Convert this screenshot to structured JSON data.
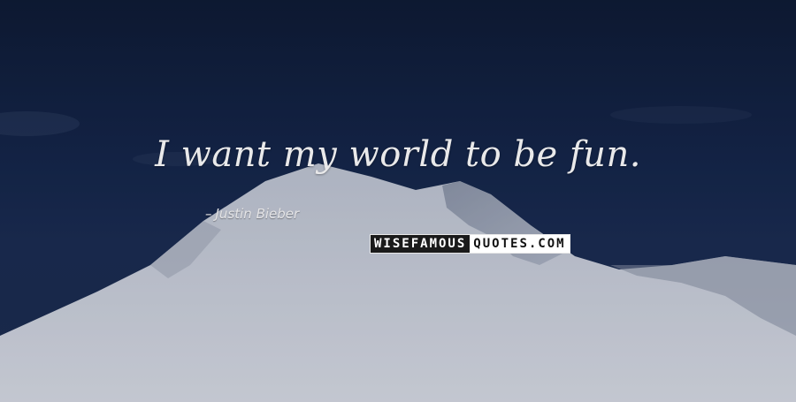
{
  "quote": {
    "text": "I want my world to be fun.",
    "author": "Justin Bieber",
    "author_marker": "–"
  },
  "watermark": {
    "part_a": "WISEFAMOUS",
    "part_b": "QUOTES.COM"
  },
  "colors": {
    "sky_top": "#0e1a33",
    "sky_bottom": "#1d2d50",
    "snow": "#d9dde6",
    "text": "#e9e9ea"
  }
}
